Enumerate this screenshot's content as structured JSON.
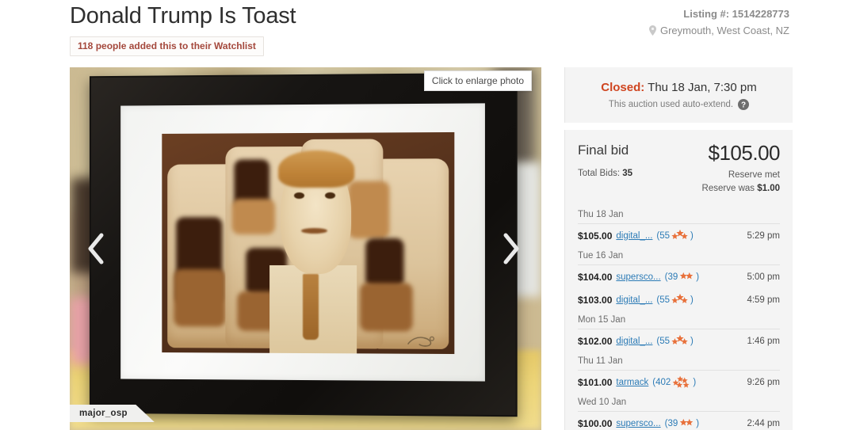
{
  "header": {
    "title": "Donald Trump Is Toast",
    "watchlist_badge": "118 people added this to their Watchlist",
    "listing_number": "Listing #: 1514228773",
    "location": "Greymouth, West Coast, NZ",
    "pin_icon": "map-pin-icon"
  },
  "photo": {
    "enlarge_tooltip": "Click to enlarge photo",
    "watermark_user": "major_osp",
    "prev_icon": "chevron-left-icon",
    "next_icon": "chevron-right-icon",
    "alt": "Framed portrait of a man made from toasted bread slices"
  },
  "status": {
    "closed_label": "Closed:",
    "closed_time": "Thu 18 Jan, 7:30 pm",
    "auto_extend_note": "This auction used auto-extend.",
    "help_icon": "help-circle-icon",
    "closed_color": "#cf4520"
  },
  "bid_summary": {
    "final_bid_label": "Final bid",
    "final_bid_amount": "$105.00",
    "total_bids_label": "Total Bids:",
    "total_bids_value": "35",
    "reserve_met": "Reserve met",
    "reserve_was_label": "Reserve was",
    "reserve_was_value": "$1.00"
  },
  "bid_history": [
    {
      "date": "Thu 18 Jan",
      "rows": [
        {
          "amount": "$105.00",
          "bidder": "digital_...",
          "rating": "55",
          "stars": 3,
          "time": "5:29 pm"
        }
      ]
    },
    {
      "date": "Tue 16 Jan",
      "rows": [
        {
          "amount": "$104.00",
          "bidder": "supersco...",
          "rating": "39",
          "stars": 2,
          "time": "5:00 pm"
        },
        {
          "amount": "$103.00",
          "bidder": "digital_...",
          "rating": "55",
          "stars": 3,
          "time": "4:59 pm"
        }
      ]
    },
    {
      "date": "Mon 15 Jan",
      "rows": [
        {
          "amount": "$102.00",
          "bidder": "digital_...",
          "rating": "55",
          "stars": 3,
          "time": "1:46 pm"
        }
      ]
    },
    {
      "date": "Thu 11 Jan",
      "rows": [
        {
          "amount": "$101.00",
          "bidder": "tarmack",
          "rating": "402",
          "stars": 5,
          "time": "9:26 pm"
        }
      ]
    },
    {
      "date": "Wed 10 Jan",
      "rows": [
        {
          "amount": "$100.00",
          "bidder": "supersco...",
          "rating": "39",
          "stars": 2,
          "time": "2:44 pm"
        }
      ]
    }
  ],
  "colors": {
    "link": "#2c7bb6",
    "star": "#e8703a",
    "watchlist_text": "#a4483c",
    "panel_bg": "#f4f4f4"
  }
}
